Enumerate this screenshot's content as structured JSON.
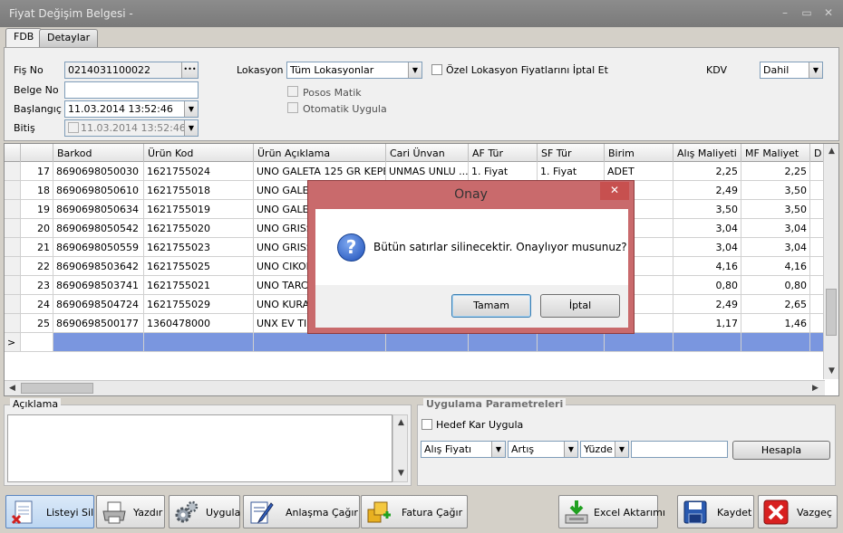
{
  "window": {
    "title": "Fiyat Değişim Belgesi -",
    "min": "–",
    "max": "▭",
    "close": "✕"
  },
  "tabs": [
    {
      "label": "FDB"
    },
    {
      "label": "Detaylar"
    }
  ],
  "form": {
    "fis_no_label": "Fiş No",
    "fis_no_value": "0214031100022",
    "fis_no_btn": "•••",
    "belge_no_label": "Belge No",
    "belge_no_value": "",
    "baslangic_label": "Başlangıç",
    "baslangic_value": "11.03.2014 13:52:46",
    "bitis_label": "Bitiş",
    "bitis_value": "11.03.2014 13:52:46",
    "lokasyon_label": "Lokasyon",
    "lokasyon_value": "Tüm Lokasyonlar",
    "ozel_label": "Özel Lokasyon Fiyatlarını İptal Et",
    "posos_label": "Posos Matik",
    "otomatik_label": "Otomatik Uygula",
    "kdv_label": "KDV",
    "kdv_value": "Dahil"
  },
  "grid": {
    "columns": [
      "Barkod",
      "Ürün Kod",
      "Ürün Açıklama",
      "Cari Ünvan",
      "AF Tür",
      "SF Tür",
      "Birim",
      "Alış Maliyeti",
      "MF Maliyet",
      "D"
    ],
    "rows": [
      {
        "no": "17",
        "barkod": "8690698050030",
        "kod": "1621755024",
        "aciklama": "UNO GALETA 125 GR KEPE...",
        "cari": "UNMAS UNLU ...",
        "af": "1. Fiyat",
        "sf": "1. Fiyat",
        "birim": "ADET",
        "alis": "2,25",
        "mf": "2,25"
      },
      {
        "no": "18",
        "barkod": "8690698050610",
        "kod": "1621755018",
        "aciklama": "UNO GALET",
        "cari": "",
        "af": "",
        "sf": "",
        "birim": "",
        "alis": "2,49",
        "mf": "3,50"
      },
      {
        "no": "19",
        "barkod": "8690698050634",
        "kod": "1621755019",
        "aciklama": "UNO  GALET",
        "cari": "",
        "af": "",
        "sf": "",
        "birim": "",
        "alis": "3,50",
        "mf": "3,50"
      },
      {
        "no": "20",
        "barkod": "8690698050542",
        "kod": "1621755020",
        "aciklama": "UNO GRISSI",
        "cari": "",
        "af": "",
        "sf": "",
        "birim": "",
        "alis": "3,04",
        "mf": "3,04"
      },
      {
        "no": "21",
        "barkod": "8690698050559",
        "kod": "1621755023",
        "aciklama": "UNO GRISSI",
        "cari": "",
        "af": "",
        "sf": "",
        "birim": "",
        "alis": "3,04",
        "mf": "3,04"
      },
      {
        "no": "22",
        "barkod": "8690698503642",
        "kod": "1621755025",
        "aciklama": "UNO CIKOL",
        "cari": "",
        "af": "",
        "sf": "",
        "birim": "",
        "alis": "4,16",
        "mf": "4,16"
      },
      {
        "no": "23",
        "barkod": "8690698503741",
        "kod": "1621755021",
        "aciklama": "UNO TARCI",
        "cari": "",
        "af": "",
        "sf": "",
        "birim": "",
        "alis": "0,80",
        "mf": "0,80"
      },
      {
        "no": "24",
        "barkod": "8690698504724",
        "kod": "1621755029",
        "aciklama": "UNO KURAB",
        "cari": "",
        "af": "",
        "sf": "",
        "birim": "",
        "alis": "2,49",
        "mf": "2,65"
      },
      {
        "no": "25",
        "barkod": "8690698500177",
        "kod": "1360478000",
        "aciklama": "UNX EV TIPI",
        "cari": "",
        "af": "",
        "sf": "",
        "birim": "",
        "alis": "1,17",
        "mf": "1,46"
      }
    ],
    "new_row_marker": ">"
  },
  "aciklama": {
    "label": "Açıklama"
  },
  "params": {
    "title": "Uygulama Parametreleri",
    "hedef_label": "Hedef Kar Uygula",
    "select1": "Alış Fiyatı",
    "select2": "Artış",
    "select3": "Yüzde",
    "value": "",
    "hesapla": "Hesapla"
  },
  "toolbar": {
    "listeyi_sil": "Listeyi Sil",
    "yazdir": "Yazdır",
    "uygula": "Uygula",
    "anlasma": "Anlaşma Çağır",
    "fatura": "Fatura Çağır",
    "excel": "Excel Aktarımı",
    "kaydet": "Kaydet",
    "vazgec": "Vazgeç"
  },
  "dialog": {
    "title": "Onay",
    "close": "✕",
    "message": "Bütün satırlar silinecektir. Onaylıyor musunuz?",
    "icon_text": "?",
    "ok": "Tamam",
    "cancel": "İptal"
  },
  "colors": {
    "selected_row": "#7a96df",
    "dialog_frame": "#c96a6c",
    "titlebar": "#868686"
  }
}
